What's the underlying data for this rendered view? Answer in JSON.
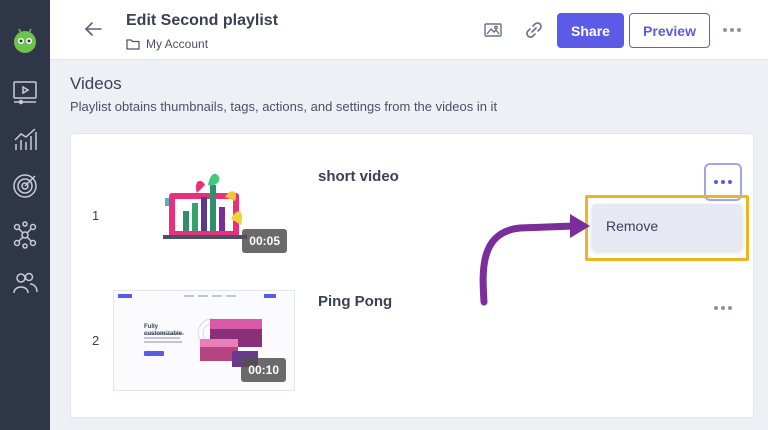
{
  "header": {
    "title": "Edit Second playlist",
    "breadcrumb": "My Account",
    "share_label": "Share",
    "preview_label": "Preview"
  },
  "section": {
    "title": "Videos",
    "description": "Playlist obtains thumbnails, tags, actions, and settings from the videos in it"
  },
  "videos": [
    {
      "index": "1",
      "title": "short video",
      "duration": "00:05"
    },
    {
      "index": "2",
      "title": "Ping Pong",
      "duration": "00:10"
    }
  ],
  "thumbnail2": {
    "headline_line1": "Fully",
    "headline_line2": "customizable"
  },
  "menu": {
    "remove_label": "Remove"
  },
  "icons": {
    "sidebar": [
      "logo-icon",
      "video-icon",
      "analytics-icon",
      "target-icon",
      "network-icon",
      "users-icon"
    ],
    "header": [
      "back-arrow-icon",
      "folder-icon",
      "image-icon",
      "link-icon",
      "more-icon"
    ]
  },
  "colors": {
    "accent": "#5b5be8",
    "sidebar": "#2f3648",
    "highlight": "#f0b323",
    "arrow": "#7b2d9a"
  }
}
